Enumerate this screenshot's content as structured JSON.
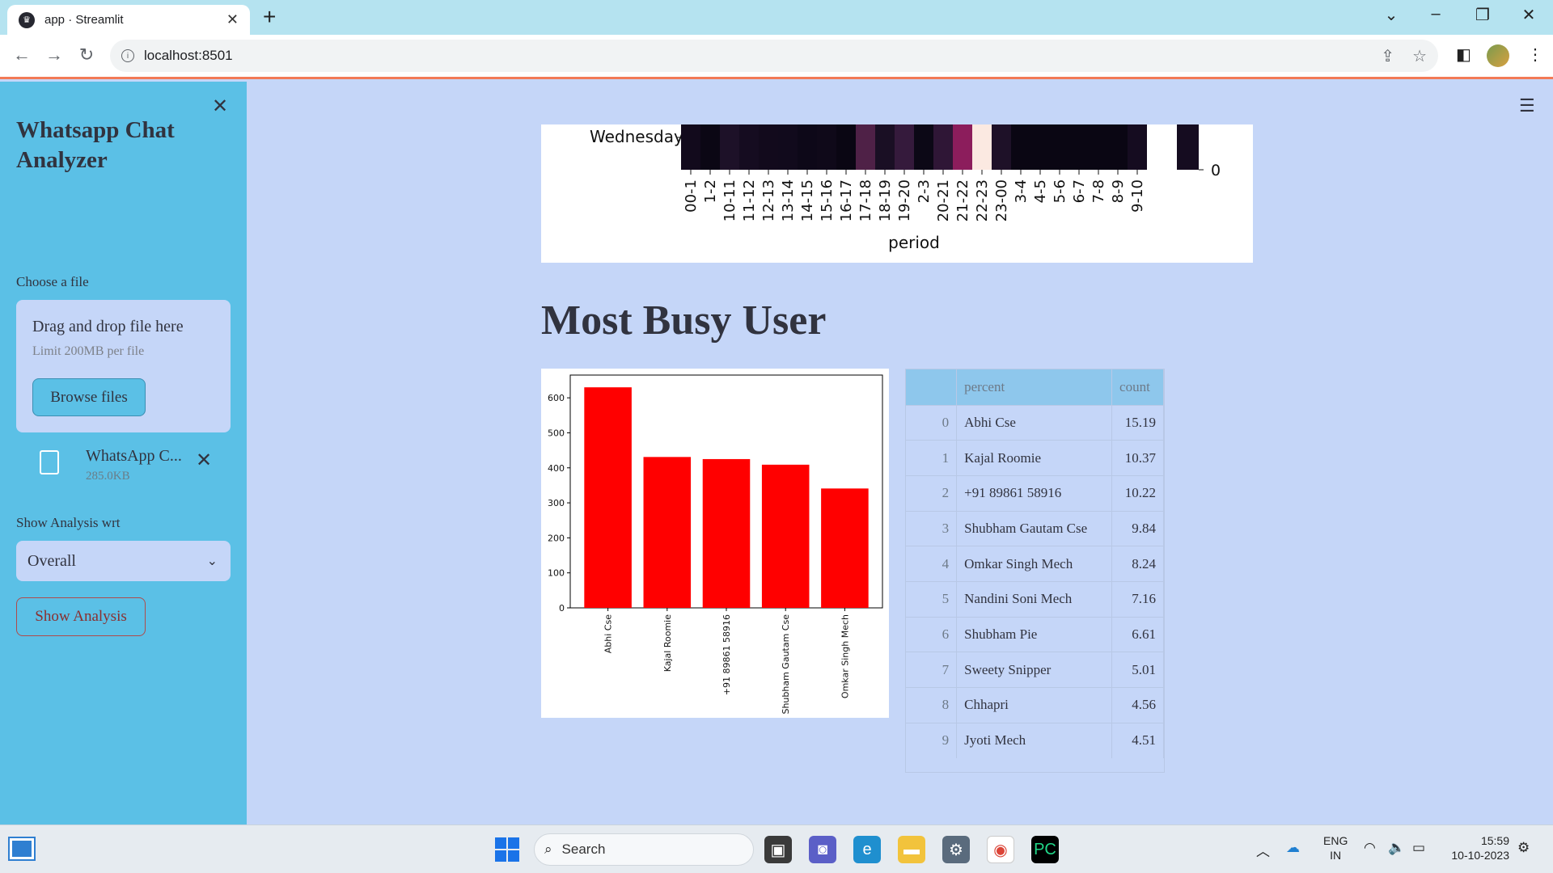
{
  "browser": {
    "tab_title": "app · Streamlit",
    "url": "localhost:8501"
  },
  "sidebar": {
    "title": "Whatsapp Chat Analyzer",
    "file_label": "Choose a file",
    "dropzone_title": "Drag and drop file here",
    "dropzone_limit": "Limit 200MB per file",
    "browse_label": "Browse files",
    "uploaded_file_name": "WhatsApp C...",
    "uploaded_file_size": "285.0KB",
    "analysis_label": "Show Analysis wrt",
    "select_value": "Overall",
    "show_button": "Show Analysis"
  },
  "heatmap": {
    "row_label": "Wednesday",
    "xlabel": "period",
    "colorbar_tick": "0",
    "periods": [
      "00-1",
      "1-2",
      "10-11",
      "11-12",
      "12-13",
      "13-14",
      "14-15",
      "15-16",
      "16-17",
      "17-18",
      "18-19",
      "19-20",
      "2-3",
      "20-21",
      "21-22",
      "22-23",
      "23-00",
      "3-4",
      "4-5",
      "5-6",
      "6-7",
      "7-8",
      "8-9",
      "9-10"
    ],
    "cell_colors": [
      "#120a1c",
      "#0b0714",
      "#1d1128",
      "#150c20",
      "#120a1c",
      "#110a1c",
      "#0d0818",
      "#0f0919",
      "#0a0613",
      "#4f2147",
      "#1a0f24",
      "#351a3c",
      "#0c0816",
      "#2f1636",
      "#8c1d5c",
      "#fbe9e1",
      "#1e1128",
      "#0a0613",
      "#0a0613",
      "#0a0613",
      "#0a0613",
      "#0a0613",
      "#0a0613",
      "#150c20"
    ]
  },
  "busy_section": {
    "title": "Most Busy User"
  },
  "chart_data": {
    "type": "bar",
    "categories": [
      "Abhi Cse",
      "Kajal Roomie",
      "+91 89861 58916",
      "Shubham Gautam Cse",
      "Omkar Singh Mech"
    ],
    "values": [
      630,
      431,
      425,
      409,
      341
    ],
    "ylim": [
      0,
      665
    ],
    "yticks": [
      0,
      100,
      200,
      300,
      400,
      500,
      600
    ],
    "color": "#ff0000"
  },
  "table": {
    "headers": [
      "",
      "percent",
      "count"
    ],
    "rows": [
      {
        "idx": "0",
        "name": "Abhi Cse",
        "value": "15.19"
      },
      {
        "idx": "1",
        "name": "Kajal Roomie",
        "value": "10.37"
      },
      {
        "idx": "2",
        "name": "+91 89861 58916",
        "value": "10.22"
      },
      {
        "idx": "3",
        "name": "Shubham Gautam Cse",
        "value": "9.84"
      },
      {
        "idx": "4",
        "name": "Omkar Singh Mech",
        "value": "8.24"
      },
      {
        "idx": "5",
        "name": "Nandini Soni Mech",
        "value": "7.16"
      },
      {
        "idx": "6",
        "name": "Shubham Pie",
        "value": "6.61"
      },
      {
        "idx": "7",
        "name": "Sweety Snipper",
        "value": "5.01"
      },
      {
        "idx": "8",
        "name": "Chhapri",
        "value": "4.56"
      },
      {
        "idx": "9",
        "name": "Jyoti Mech",
        "value": "4.51"
      }
    ]
  },
  "taskbar": {
    "search_placeholder": "Search",
    "lang_line1": "ENG",
    "lang_line2": "IN",
    "time": "15:59",
    "date": "10-10-2023"
  }
}
